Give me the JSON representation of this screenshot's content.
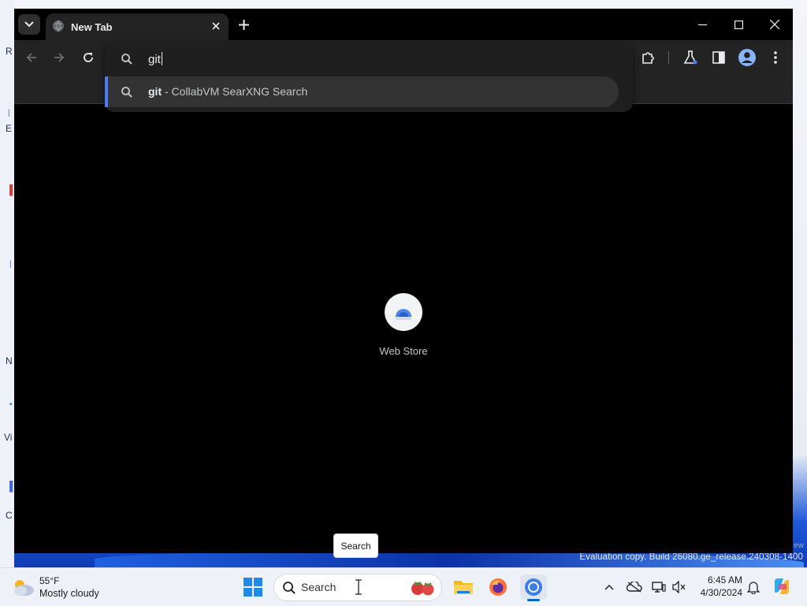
{
  "browser": {
    "tab": {
      "title": "New Tab"
    },
    "omnibox": {
      "value": "git",
      "suggestion": {
        "query": "git",
        "suffix": " - CollabVM SearXNG Search"
      }
    },
    "shortcuts": [
      {
        "label": "Web Store",
        "icon": "web-store-icon"
      }
    ]
  },
  "tooltip": {
    "text": "Search"
  },
  "desktop": {
    "watermark": "Evaluation copy. Build 26080.ge_release.240308-1400",
    "watermark_tail": "ew",
    "edge_glyphs": [
      "R",
      "E",
      "N",
      "Vi",
      "C"
    ]
  },
  "taskbar": {
    "weather": {
      "temp": "55°F",
      "condition": "Mostly cloudy"
    },
    "search": {
      "placeholder": "Search"
    },
    "apps": [
      "file-explorer",
      "firefox",
      "chrome"
    ],
    "clock": {
      "time": "6:45 AM",
      "date": "4/30/2024"
    }
  },
  "colors": {
    "accent": "#4b7cf5",
    "browser_bg": "#000000",
    "toolbar_bg": "#232323",
    "taskbar_bg": "#eef1f8"
  }
}
